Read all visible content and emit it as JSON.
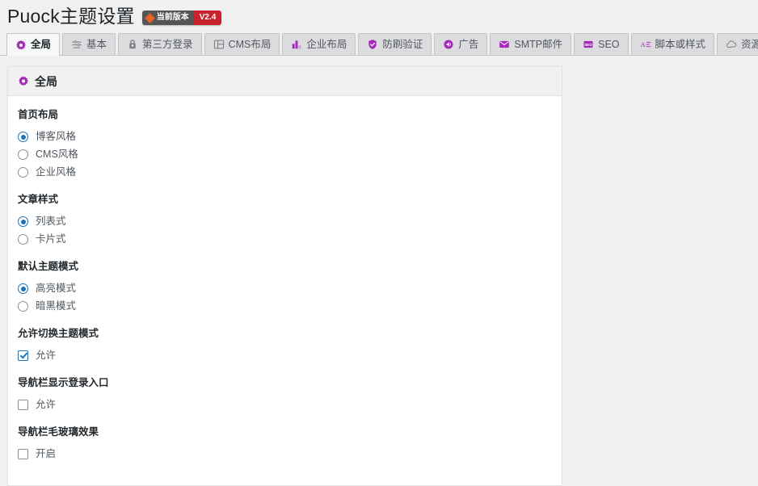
{
  "header": {
    "title": "Puock主题设置",
    "badge": {
      "icon": "diamond-icon",
      "label": "当前版本",
      "version": "V2.4",
      "left_color": "#555555",
      "right_color": "#c6232a",
      "icon_color": "#e8622a"
    }
  },
  "tabs": [
    {
      "label": "全局",
      "icon": "gear-icon",
      "active": true
    },
    {
      "label": "基本",
      "icon": "sliders-icon",
      "active": false
    },
    {
      "label": "第三方登录",
      "icon": "lock-icon",
      "active": false
    },
    {
      "label": "CMS布局",
      "icon": "layout-icon",
      "active": false
    },
    {
      "label": "企业布局",
      "icon": "chart-icon",
      "active": false
    },
    {
      "label": "防刷验证",
      "icon": "shield-check-icon",
      "active": false
    },
    {
      "label": "广告",
      "icon": "megaphone-icon",
      "active": false
    },
    {
      "label": "SMTP邮件",
      "icon": "mail-icon",
      "active": false
    },
    {
      "label": "SEO",
      "icon": "seo-icon",
      "active": false
    },
    {
      "label": "脚本或样式",
      "icon": "code-icon",
      "active": false
    },
    {
      "label": "资源或更新",
      "icon": "cloud-icon",
      "active": false
    }
  ],
  "panel": {
    "icon": "gear-icon",
    "title": "全局",
    "fields": [
      {
        "label": "首页布局",
        "type": "radio",
        "options": [
          {
            "text": "博客风格",
            "checked": true
          },
          {
            "text": "CMS风格",
            "checked": false
          },
          {
            "text": "企业风格",
            "checked": false
          }
        ]
      },
      {
        "label": "文章样式",
        "type": "radio",
        "options": [
          {
            "text": "列表式",
            "checked": true
          },
          {
            "text": "卡片式",
            "checked": false
          }
        ]
      },
      {
        "label": "默认主题模式",
        "type": "radio",
        "options": [
          {
            "text": "高亮模式",
            "checked": true
          },
          {
            "text": "暗黑模式",
            "checked": false
          }
        ]
      },
      {
        "label": "允许切换主题模式",
        "type": "checkbox",
        "options": [
          {
            "text": "允许",
            "checked": true
          }
        ]
      },
      {
        "label": "导航栏显示登录入口",
        "type": "checkbox",
        "options": [
          {
            "text": "允许",
            "checked": false
          }
        ]
      },
      {
        "label": "导航栏毛玻璃效果",
        "type": "checkbox",
        "options": [
          {
            "text": "开启",
            "checked": false
          }
        ]
      }
    ]
  },
  "colors": {
    "accent_purple": "#a32bb8",
    "accent_blue": "#2271b1",
    "page_bg": "#f0f0f1"
  }
}
